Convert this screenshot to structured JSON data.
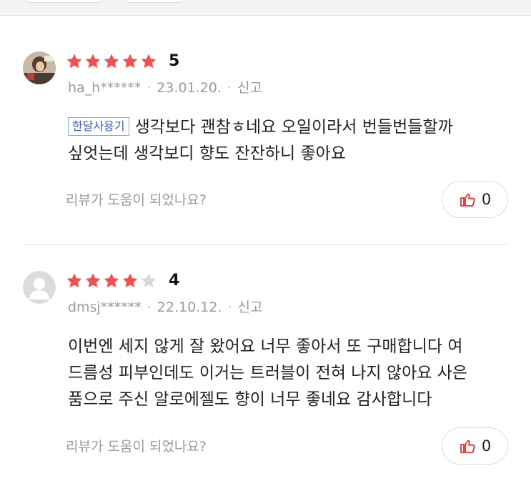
{
  "colors": {
    "star_on": "#f0504f",
    "star_off": "#d9d9d9",
    "tag": "#3a5fb8",
    "like_icon": "#e2302b"
  },
  "reviews": [
    {
      "avatar_icon": "user-photo-avatar",
      "rating_stars": 5,
      "rating": "5",
      "username": "ha_h******",
      "date": "23.01.20.",
      "report_label": "신고",
      "tag": "한달사용기",
      "line1": "생각보다 괜참ㅎ네요 오일이라서 번들번들할까",
      "line2": "싶엇는데 생각보디 향도 잔잔하니 좋아요",
      "helpful_question": "리뷰가 도움이 되었나요?",
      "like_icon": "thumbs-up-icon",
      "likes": "0"
    },
    {
      "avatar_icon": "default-user-avatar",
      "rating_stars": 4,
      "rating": "4",
      "username": "dmsj******",
      "date": "22.10.12.",
      "report_label": "신고",
      "line1": "이번엔 세지 않게 잘 왔어요 너무 좋아서 또 구매합니다 여",
      "line2": "드름성 피부인데도 이거는 트러블이 전혀 나지 않아요 사은",
      "line3": "품으로 주신 알로에젤도 향이 너무 좋네요 감사합니다",
      "helpful_question": "리뷰가 도움이 되었나요?",
      "like_icon": "thumbs-up-icon",
      "likes": "0"
    }
  ]
}
